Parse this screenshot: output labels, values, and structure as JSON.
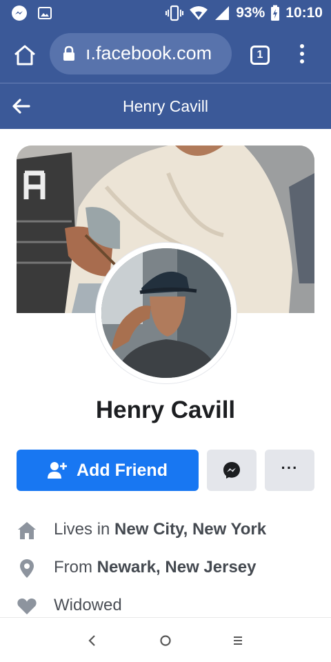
{
  "status_bar": {
    "battery": "93%",
    "time": "10:10",
    "icons": [
      "messenger-notification-icon",
      "gallery-notification-icon",
      "vibrate-icon",
      "wifi-icon",
      "signal-icon",
      "battery-charging-icon"
    ]
  },
  "browser": {
    "url": "ı.facebook.com",
    "tab_count": "1",
    "icons": [
      "home-icon",
      "lock-icon",
      "overflow-menu-icon"
    ]
  },
  "header": {
    "title": "Henry Cavill",
    "icon": "back-arrow-icon"
  },
  "profile": {
    "name": "Henry Cavill",
    "add_friend_label": "Add Friend",
    "more_label": "···",
    "icons": [
      "add-friend-icon",
      "messenger-icon"
    ]
  },
  "info": [
    {
      "icon": "home-icon",
      "prefix": "Lives in ",
      "value": "New City, New York"
    },
    {
      "icon": "location-pin-icon",
      "prefix": "From ",
      "value": "Newark, New Jersey"
    },
    {
      "icon": "heart-icon",
      "prefix": "",
      "value": "Widowed"
    }
  ],
  "nav": {
    "icons": [
      "back-nav-icon",
      "home-nav-icon",
      "recents-nav-icon"
    ]
  },
  "colors": {
    "header_bg": "#3b5998",
    "url_pill": "#5873ac",
    "primary_button": "#1877f2",
    "secondary_button": "#e4e6eb"
  }
}
